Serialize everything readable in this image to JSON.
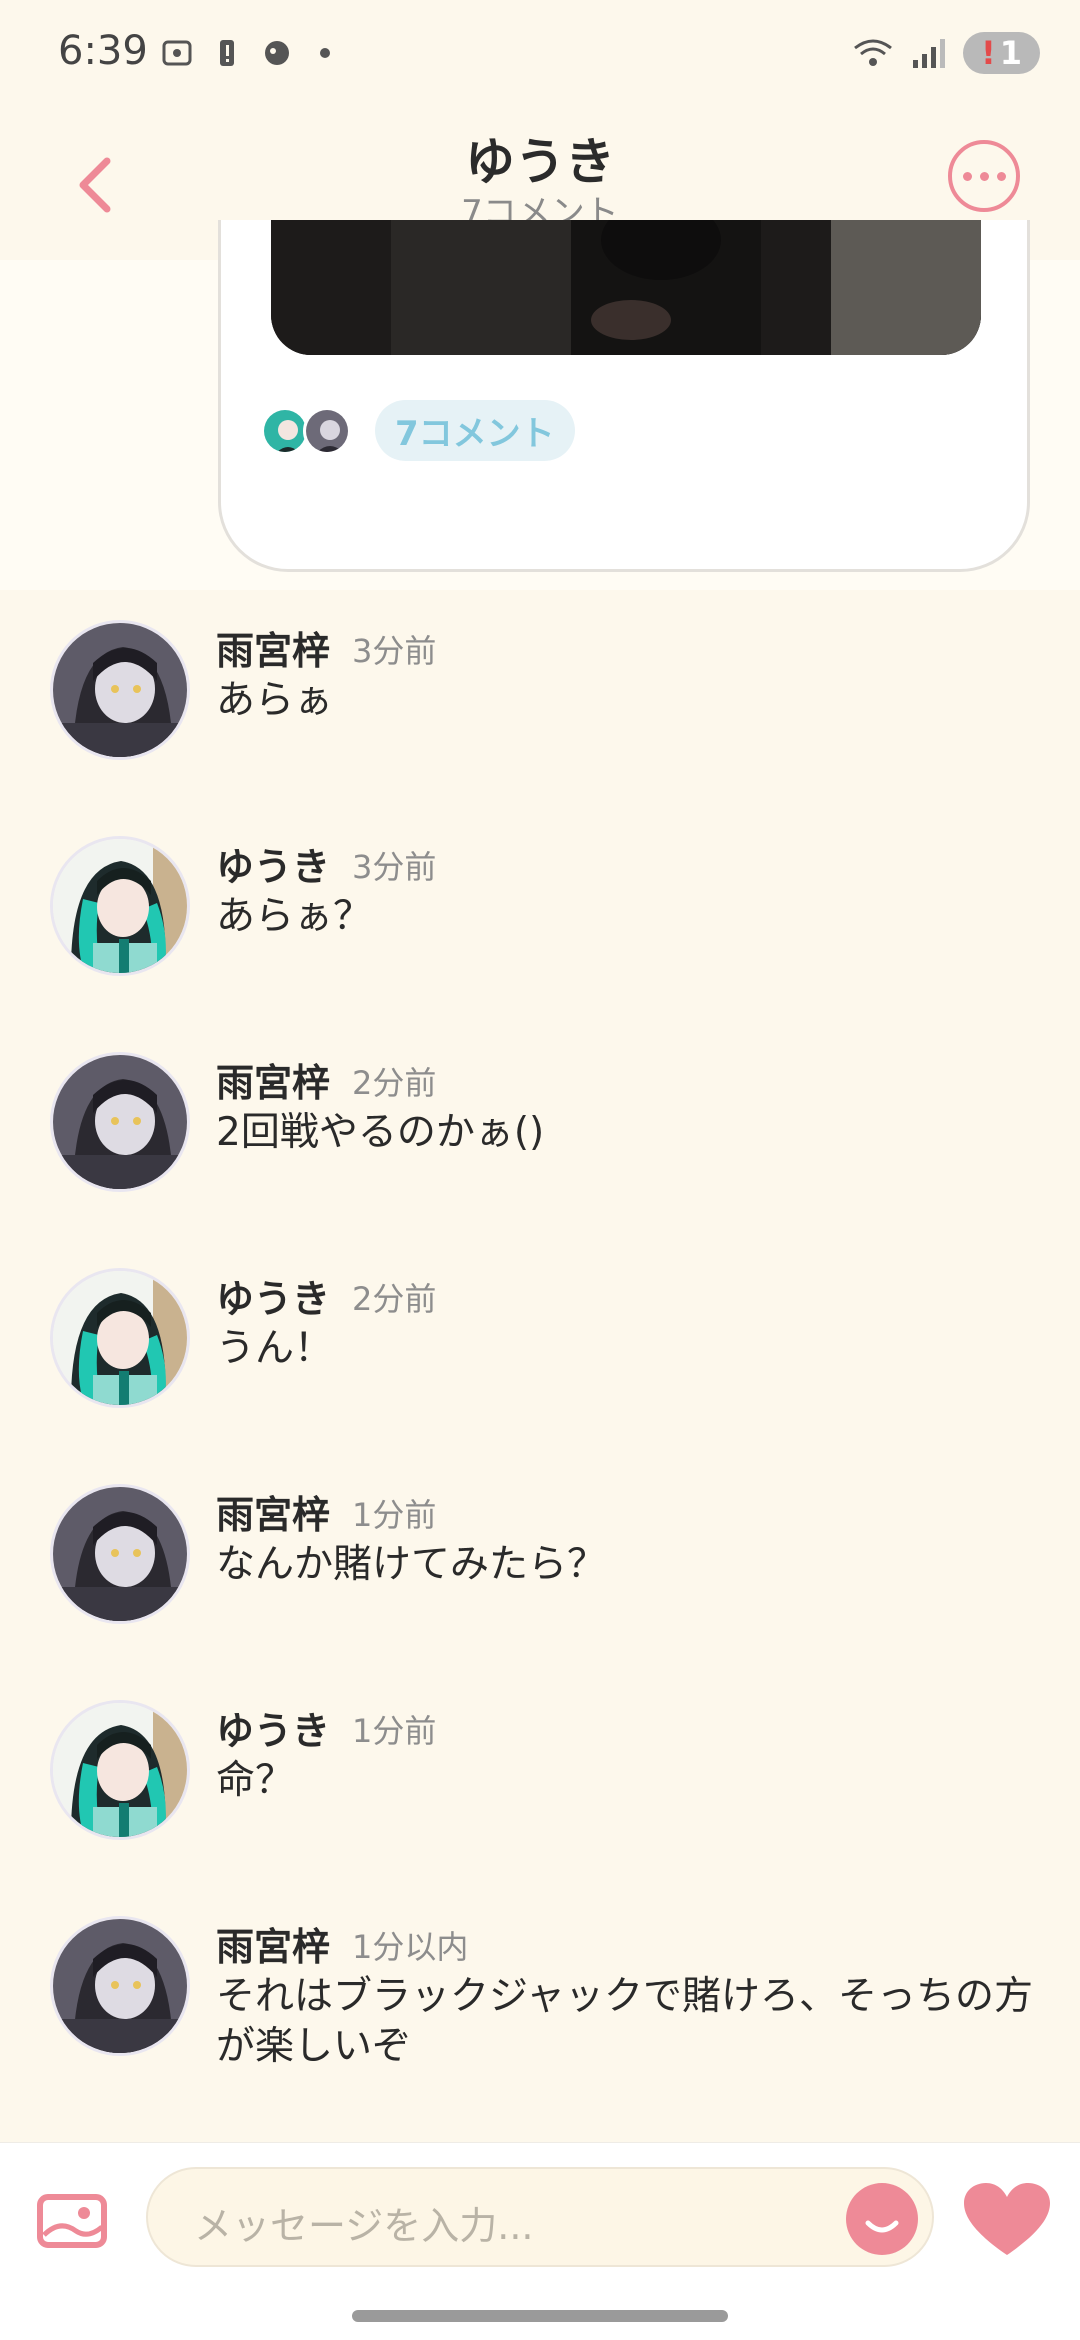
{
  "status_bar": {
    "time": "6:39",
    "badge": "1"
  },
  "header": {
    "title": "ゆうき",
    "subtitle": "7コメント"
  },
  "post": {
    "comment_chip": "7コメント"
  },
  "comments": [
    {
      "name": "雨宮梓",
      "time": "3分前",
      "text": "あらぁ",
      "avatar": "gray"
    },
    {
      "name": "ゆうき",
      "time": "3分前",
      "text": "あらぁ？",
      "avatar": "teal"
    },
    {
      "name": "雨宮梓",
      "time": "2分前",
      "text": "2回戦やるのかぁ()",
      "avatar": "gray"
    },
    {
      "name": "ゆうき",
      "time": "2分前",
      "text": "うん！",
      "avatar": "teal"
    },
    {
      "name": "雨宮梓",
      "time": "1分前",
      "text": "なんか賭けてみたら？",
      "avatar": "gray"
    },
    {
      "name": "ゆうき",
      "time": "1分前",
      "text": "命？",
      "avatar": "teal"
    },
    {
      "name": "雨宮梓",
      "time": "1分以内",
      "text": "それはブラックジャックで賭けろ、そっちの方が楽しいぞ",
      "avatar": "gray"
    }
  ],
  "input": {
    "placeholder": "メッセージを入力..."
  },
  "colors": {
    "accent": "#ee8a97",
    "background": "#FDF8EC",
    "chip_text": "#82c7dd"
  }
}
